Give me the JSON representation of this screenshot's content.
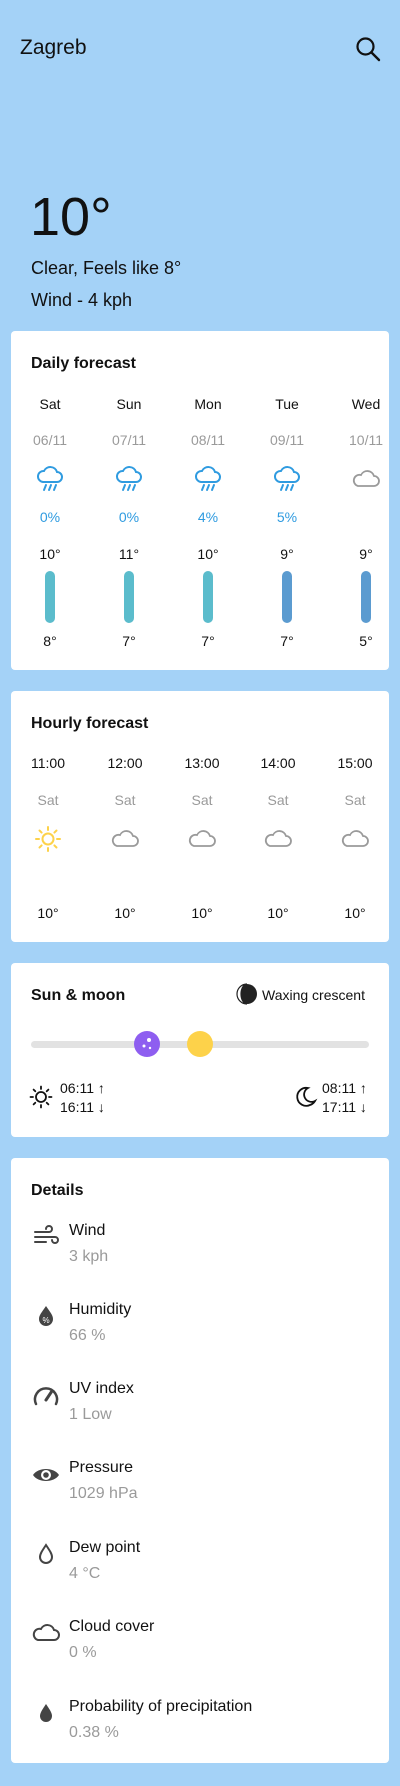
{
  "topbar": {
    "city": "Zagreb"
  },
  "current": {
    "temp": "10°",
    "condition": "Clear, Feels like 8°",
    "wind": "Wind - 4 kph"
  },
  "daily": {
    "title": "Daily forecast",
    "days": [
      {
        "day": "Sat",
        "date": "06/11",
        "icon": "rain-cloud-icon",
        "precip": "0%",
        "high": "10°",
        "low": "8°"
      },
      {
        "day": "Sun",
        "date": "07/11",
        "icon": "rain-cloud-icon",
        "precip": "0%",
        "high": "11°",
        "low": "7°"
      },
      {
        "day": "Mon",
        "date": "08/11",
        "icon": "rain-cloud-icon",
        "precip": "4%",
        "high": "10°",
        "low": "7°"
      },
      {
        "day": "Tue",
        "date": "09/11",
        "icon": "rain-cloud-icon",
        "precip": "5%",
        "high": "9°",
        "low": "7°"
      },
      {
        "day": "Wed",
        "date": "10/11",
        "icon": "cloud-icon",
        "precip": "",
        "high": "9°",
        "low": "5°"
      }
    ]
  },
  "hourly": {
    "title": "Hourly forecast",
    "hours": [
      {
        "time": "11:00",
        "day": "Sat",
        "icon": "sun-icon",
        "temp": "10°"
      },
      {
        "time": "12:00",
        "day": "Sat",
        "icon": "cloud-icon",
        "temp": "10°"
      },
      {
        "time": "13:00",
        "day": "Sat",
        "icon": "cloud-icon",
        "temp": "10°"
      },
      {
        "time": "14:00",
        "day": "Sat",
        "icon": "cloud-icon",
        "temp": "10°"
      },
      {
        "time": "15:00",
        "day": "Sat",
        "icon": "cloud-icon",
        "temp": "10°"
      }
    ]
  },
  "sunmoon": {
    "title": "Sun & moon",
    "moon_phase": "Waxing crescent",
    "sunrise": "06:11 ↑",
    "sunset": "16:11 ↓",
    "moonrise": "08:11 ↑",
    "moonset": "17:11 ↓"
  },
  "details": {
    "title": "Details",
    "items": [
      {
        "label": "Wind",
        "value": "3 kph",
        "icon": "wind-icon"
      },
      {
        "label": "Humidity",
        "value": "66 %",
        "icon": "humidity-icon"
      },
      {
        "label": "UV index",
        "value": "1 Low",
        "icon": "gauge-icon"
      },
      {
        "label": "Pressure",
        "value": "1029 hPa",
        "icon": "eye-icon"
      },
      {
        "label": "Dew point",
        "value": "4 °C",
        "icon": "drop-outline-icon"
      },
      {
        "label": "Cloud cover",
        "value": "0 %",
        "icon": "cloud-outline-icon"
      },
      {
        "label": "Probability of precipitation",
        "value": "0.38 %",
        "icon": "drop-filled-icon"
      }
    ]
  },
  "colors": {
    "background": "#a4d2f7",
    "precip_blue": "#2f9be0",
    "bar_teal": "#5bbccc",
    "bar_blue": "#5b9bd0",
    "moon_purple": "#8e5ef0",
    "sun_yellow": "#fdd24a"
  }
}
